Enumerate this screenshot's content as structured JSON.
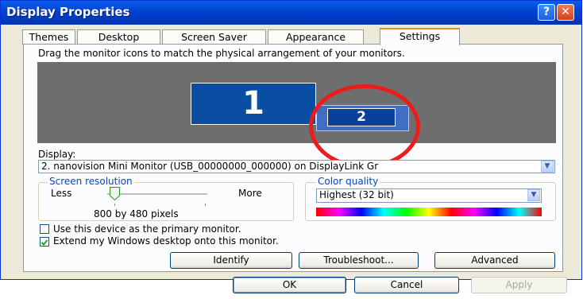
{
  "window": {
    "title": "Display Properties",
    "help_glyph": "?",
    "close_glyph": "✕"
  },
  "tabs": [
    {
      "label": "Themes"
    },
    {
      "label": "Desktop"
    },
    {
      "label": "Screen Saver"
    },
    {
      "label": "Appearance"
    },
    {
      "label": "Settings",
      "active": true
    }
  ],
  "settings": {
    "instructions": "Drag the monitor icons to match the physical arrangement of your monitors.",
    "monitors": [
      {
        "number": "1"
      },
      {
        "number": "2",
        "selected": true
      }
    ],
    "display_label": "Display:",
    "display_value": "2. nanovision Mini Monitor (USB_00000000_000000) on DisplayLink Gr",
    "resolution": {
      "group_label": "Screen resolution",
      "less": "Less",
      "more": "More",
      "value_text": "800 by 480 pixels",
      "slider_position": 0.0
    },
    "color_quality": {
      "group_label": "Color quality",
      "selected": "Highest (32 bit)"
    },
    "checkboxes": [
      {
        "label": "Use this device as the primary monitor.",
        "checked": false
      },
      {
        "label": "Extend my Windows desktop onto this monitor.",
        "checked": true
      }
    ],
    "buttons": {
      "identify": "Identify",
      "troubleshoot": "Troubleshoot...",
      "advanced": "Advanced"
    }
  },
  "dialog_buttons": {
    "ok": "OK",
    "cancel": "Cancel",
    "apply": "Apply"
  },
  "colors": {
    "title_bar": "#0041d0",
    "window_bg": "#ece9d8",
    "highlight_circle": "#ee1b1b",
    "desktop_bg": "#6e6e6e"
  }
}
